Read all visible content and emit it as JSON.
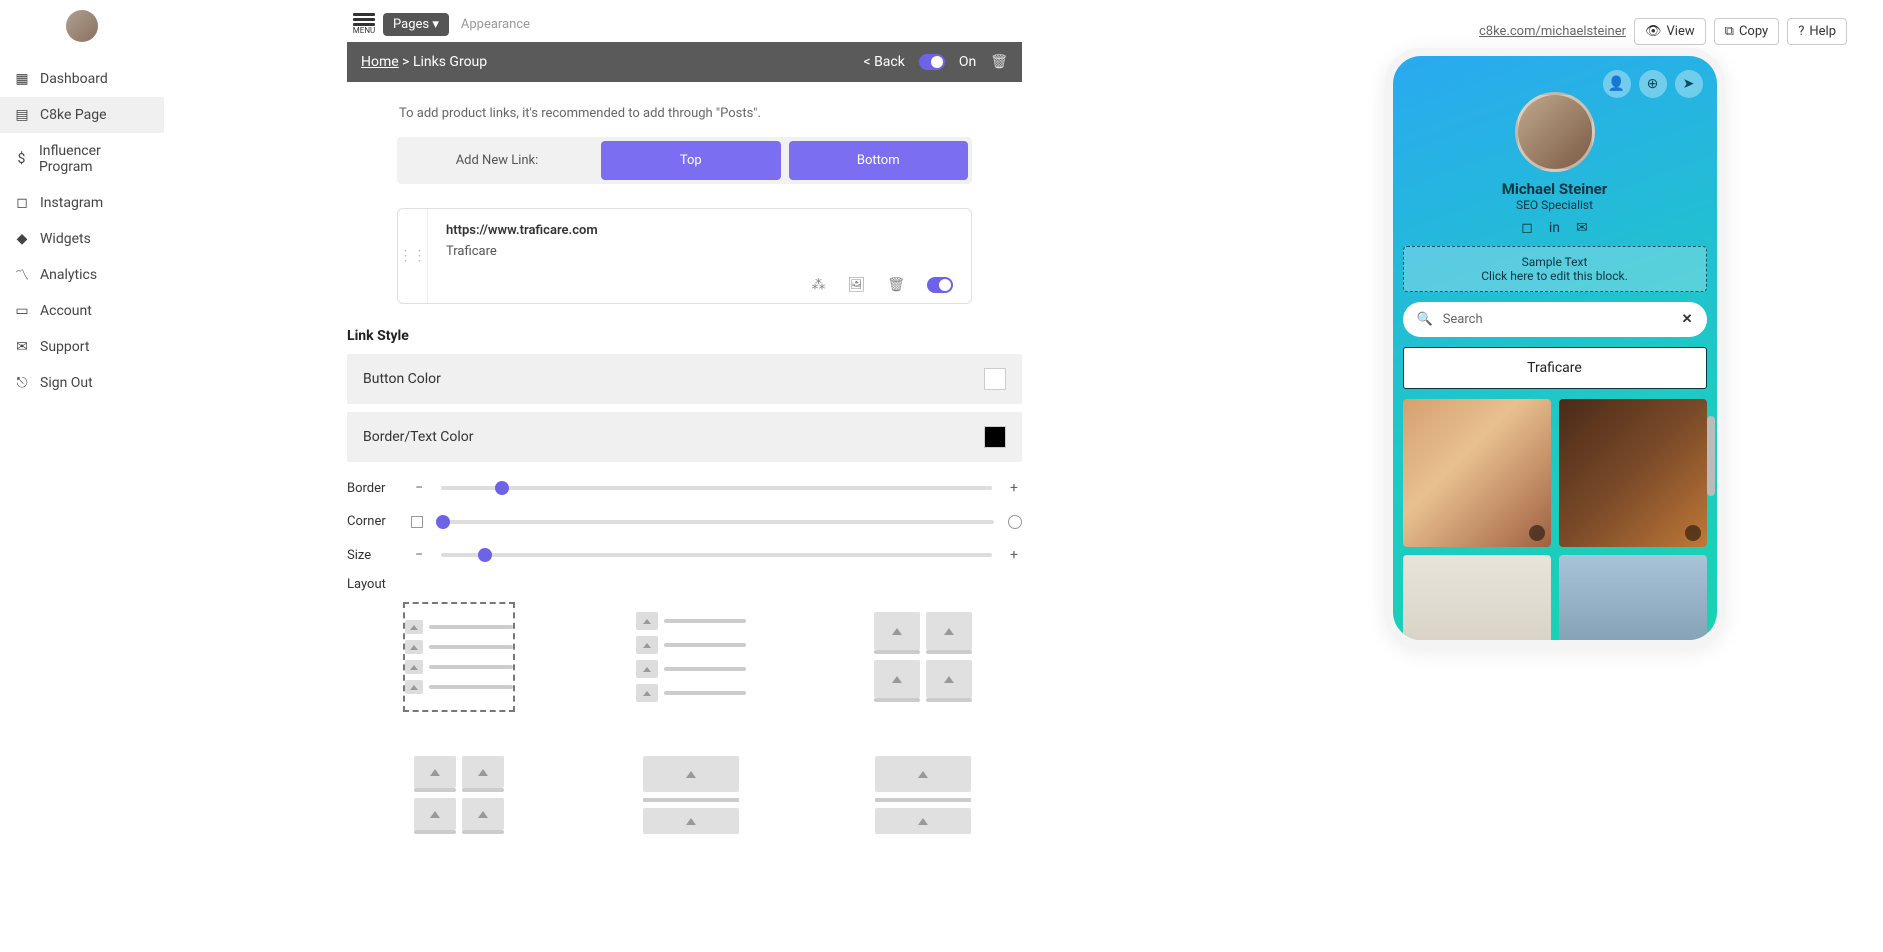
{
  "sidebar": {
    "items": [
      {
        "label": "Dashboard"
      },
      {
        "label": "C8ke Page"
      },
      {
        "label": "Influencer Program"
      },
      {
        "label": "Instagram"
      },
      {
        "label": "Widgets"
      },
      {
        "label": "Analytics"
      },
      {
        "label": "Account"
      },
      {
        "label": "Support"
      },
      {
        "label": "Sign Out"
      }
    ]
  },
  "topbar": {
    "menu_label": "MENU",
    "pages_tab": "Pages ▾",
    "appearance_tab": "Appearance"
  },
  "breadcrumb": {
    "home": "Home",
    "sep_group": " > Links Group",
    "back": "< Back",
    "on_label": "On"
  },
  "editor": {
    "tip": "To add product links, it's recommended to add through \"Posts\".",
    "add_new_link": "Add New Link:",
    "top_btn": "Top",
    "bottom_btn": "Bottom",
    "link": {
      "url": "https://www.traficare.com",
      "title": "Traficare"
    },
    "link_style_heading": "Link Style",
    "button_color": "Button Color",
    "border_text_color": "Border/Text Color",
    "sliders": {
      "border": "Border",
      "corner": "Corner",
      "size": "Size",
      "border_pos": 11,
      "corner_pos": 1,
      "size_pos": 8
    },
    "layout_label": "Layout",
    "colors": {
      "button_color_value": "#ffffff",
      "border_text_color_value": "#000000",
      "accent": "#6e63e6"
    }
  },
  "preview": {
    "url": "c8ke.com/michaelsteiner",
    "view": "View",
    "copy": "Copy",
    "help": "Help",
    "profile": {
      "name": "Michael Steiner",
      "subtitle": "SEO Specialist"
    },
    "sample": {
      "line1": "Sample Text",
      "line2": "Click here to edit this block."
    },
    "search_placeholder": "Search",
    "traficare_btn": "Traficare"
  }
}
